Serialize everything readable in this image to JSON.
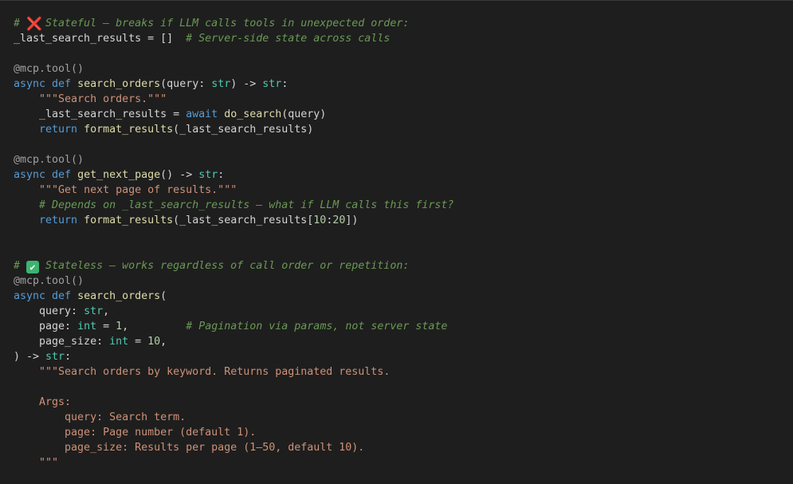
{
  "editor": {
    "theme": {
      "background": "#1e1e1e",
      "comment": "#6a9955",
      "keyword": "#569cd6",
      "function": "#dcdcaa",
      "type": "#4ec9b0",
      "string": "#ce9178",
      "number": "#b5cea8",
      "decorator": "#a0a0a0",
      "plain": "#d4d4d4"
    },
    "lines": [
      [
        {
          "t": "# ",
          "k": "comment"
        },
        {
          "t": "❌",
          "k": "emoji",
          "icon": "cross-mark"
        },
        {
          "t": " Stateful — breaks if LLM calls tools in unexpected order:",
          "k": "comment"
        }
      ],
      [
        {
          "t": "_last_search_results = []  ",
          "k": "plain"
        },
        {
          "t": "# Server-side state across calls",
          "k": "comment"
        }
      ],
      [],
      [
        {
          "t": "@mcp.tool()",
          "k": "decorator"
        }
      ],
      [
        {
          "t": "async",
          "k": "keyword"
        },
        {
          "t": " ",
          "k": "plain"
        },
        {
          "t": "def",
          "k": "keyword"
        },
        {
          "t": " ",
          "k": "plain"
        },
        {
          "t": "search_orders",
          "k": "func"
        },
        {
          "t": "(query: ",
          "k": "plain"
        },
        {
          "t": "str",
          "k": "type"
        },
        {
          "t": ") -> ",
          "k": "plain"
        },
        {
          "t": "str",
          "k": "type"
        },
        {
          "t": ":",
          "k": "plain"
        }
      ],
      [
        {
          "t": "    ",
          "k": "plain"
        },
        {
          "t": "\"\"\"Search orders.\"\"\"",
          "k": "string"
        }
      ],
      [
        {
          "t": "    _last_search_results = ",
          "k": "plain"
        },
        {
          "t": "await",
          "k": "control"
        },
        {
          "t": " ",
          "k": "plain"
        },
        {
          "t": "do_search",
          "k": "func"
        },
        {
          "t": "(query)",
          "k": "plain"
        }
      ],
      [
        {
          "t": "    ",
          "k": "plain"
        },
        {
          "t": "return",
          "k": "control"
        },
        {
          "t": " ",
          "k": "plain"
        },
        {
          "t": "format_results",
          "k": "func"
        },
        {
          "t": "(_last_search_results)",
          "k": "plain"
        }
      ],
      [],
      [
        {
          "t": "@mcp.tool()",
          "k": "decorator"
        }
      ],
      [
        {
          "t": "async",
          "k": "keyword"
        },
        {
          "t": " ",
          "k": "plain"
        },
        {
          "t": "def",
          "k": "keyword"
        },
        {
          "t": " ",
          "k": "plain"
        },
        {
          "t": "get_next_page",
          "k": "func"
        },
        {
          "t": "() -> ",
          "k": "plain"
        },
        {
          "t": "str",
          "k": "type"
        },
        {
          "t": ":",
          "k": "plain"
        }
      ],
      [
        {
          "t": "    ",
          "k": "plain"
        },
        {
          "t": "\"\"\"Get next page of results.\"\"\"",
          "k": "string"
        }
      ],
      [
        {
          "t": "    ",
          "k": "plain"
        },
        {
          "t": "# Depends on _last_search_results — what if LLM calls this first?",
          "k": "comment"
        }
      ],
      [
        {
          "t": "    ",
          "k": "plain"
        },
        {
          "t": "return",
          "k": "control"
        },
        {
          "t": " ",
          "k": "plain"
        },
        {
          "t": "format_results",
          "k": "func"
        },
        {
          "t": "(_last_search_results[",
          "k": "plain"
        },
        {
          "t": "10",
          "k": "number"
        },
        {
          "t": ":",
          "k": "plain"
        },
        {
          "t": "20",
          "k": "number"
        },
        {
          "t": "])",
          "k": "plain"
        }
      ],
      [],
      [],
      [
        {
          "t": "# ",
          "k": "comment"
        },
        {
          "t": "✔",
          "k": "emoji",
          "icon": "check-box"
        },
        {
          "t": " Stateless — works regardless of call order or repetition:",
          "k": "comment"
        }
      ],
      [
        {
          "t": "@mcp.tool()",
          "k": "decorator"
        }
      ],
      [
        {
          "t": "async",
          "k": "keyword"
        },
        {
          "t": " ",
          "k": "plain"
        },
        {
          "t": "def",
          "k": "keyword"
        },
        {
          "t": " ",
          "k": "plain"
        },
        {
          "t": "search_orders",
          "k": "func"
        },
        {
          "t": "(",
          "k": "plain"
        }
      ],
      [
        {
          "t": "    query: ",
          "k": "plain"
        },
        {
          "t": "str",
          "k": "type"
        },
        {
          "t": ",",
          "k": "plain"
        }
      ],
      [
        {
          "t": "    page: ",
          "k": "plain"
        },
        {
          "t": "int",
          "k": "type"
        },
        {
          "t": " = ",
          "k": "plain"
        },
        {
          "t": "1",
          "k": "number"
        },
        {
          "t": ",         ",
          "k": "plain"
        },
        {
          "t": "# Pagination via params, not server state",
          "k": "comment"
        }
      ],
      [
        {
          "t": "    page_size: ",
          "k": "plain"
        },
        {
          "t": "int",
          "k": "type"
        },
        {
          "t": " = ",
          "k": "plain"
        },
        {
          "t": "10",
          "k": "number"
        },
        {
          "t": ",",
          "k": "plain"
        }
      ],
      [
        {
          "t": ") -> ",
          "k": "plain"
        },
        {
          "t": "str",
          "k": "type"
        },
        {
          "t": ":",
          "k": "plain"
        }
      ],
      [
        {
          "t": "    ",
          "k": "plain"
        },
        {
          "t": "\"\"\"Search orders by keyword. Returns paginated results.",
          "k": "string"
        }
      ],
      [],
      [
        {
          "t": "    Args:",
          "k": "string"
        }
      ],
      [
        {
          "t": "        query: Search term.",
          "k": "string"
        }
      ],
      [
        {
          "t": "        page: Page number (default 1).",
          "k": "string"
        }
      ],
      [
        {
          "t": "        page_size: Results per page (1–50, default 10).",
          "k": "string"
        }
      ],
      [
        {
          "t": "    \"\"\"",
          "k": "string"
        }
      ]
    ]
  }
}
